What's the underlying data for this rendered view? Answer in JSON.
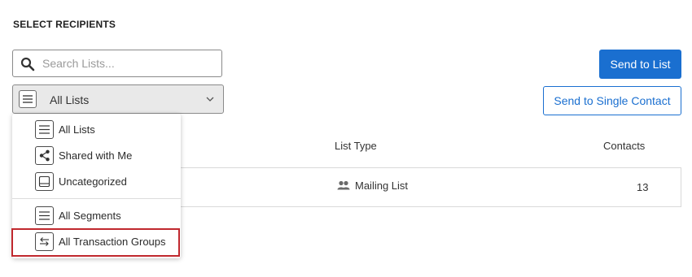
{
  "section": {
    "title": "SELECT RECIPIENTS"
  },
  "search": {
    "placeholder": "Search Lists...",
    "icon": "search-icon"
  },
  "list_filter": {
    "selected": "All Lists",
    "icon": "list-lines-icon"
  },
  "buttons": {
    "send_to_list": "Send to List",
    "send_to_single_contact": "Send to Single Contact"
  },
  "table": {
    "columns": {
      "list_type": "List Type",
      "contacts": "Contacts"
    },
    "rows": [
      {
        "type": "Mailing List",
        "contacts": "13"
      }
    ]
  },
  "dropdown": {
    "items": [
      {
        "label": "All Lists",
        "icon": "list-lines-icon"
      },
      {
        "label": "Shared with Me",
        "icon": "share-icon"
      },
      {
        "label": "Uncategorized",
        "icon": "inbox-tray-icon"
      },
      {
        "label": "All Segments",
        "icon": "list-lines-icon"
      },
      {
        "label": "All Transaction Groups",
        "icon": "transfer-arrows-icon"
      }
    ]
  },
  "colors": {
    "primary": "#1a6fd0",
    "highlight": "#c0282e"
  }
}
